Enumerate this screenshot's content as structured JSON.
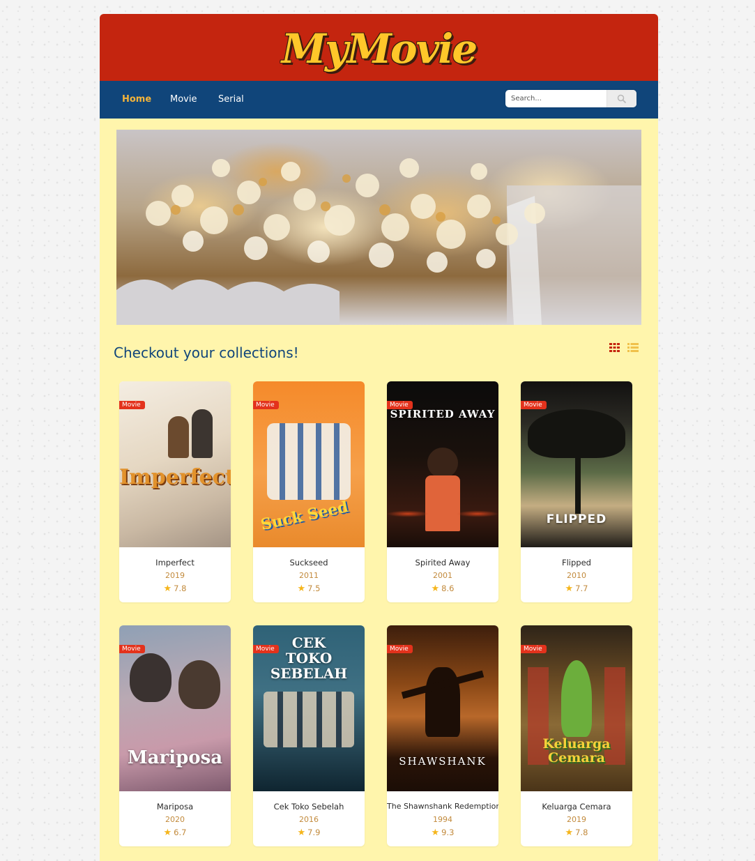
{
  "brand": {
    "logo_text": "MyMovie"
  },
  "nav": {
    "items": [
      {
        "label": "Home",
        "active": true
      },
      {
        "label": "Movie",
        "active": false
      },
      {
        "label": "Serial",
        "active": false
      }
    ],
    "search": {
      "placeholder": "Search...",
      "button_icon": "search-icon"
    }
  },
  "hero": {
    "image": "popcorn-banner",
    "alt": "popcorn"
  },
  "collections": {
    "title": "Checkout your collections!",
    "view_options": [
      {
        "icon": "grid-icon",
        "active": true,
        "color": "#c4250f"
      },
      {
        "icon": "list-icon",
        "active": false,
        "color": "#f0c14b"
      }
    ],
    "badge_color": "#e3321c",
    "items": [
      {
        "badge": "Movie",
        "title": "Imperfect",
        "year": "2019",
        "rating": "7.8",
        "poster_text": "Imperfect",
        "poster_colors": [
          "#efe6d8",
          "#c9b8a3",
          "#d6882a"
        ]
      },
      {
        "badge": "Movie",
        "title": "Suckseed",
        "year": "2011",
        "rating": "7.5",
        "poster_text": "Suck Seed",
        "poster_colors": [
          "#f39233",
          "#f6a54a",
          "#3e7bc2"
        ]
      },
      {
        "badge": "Movie",
        "title": "Spirited Away",
        "year": "2001",
        "rating": "8.6",
        "poster_text": "SPIRITED AWAY",
        "poster_colors": [
          "#0d0d0d",
          "#2a1a12",
          "#c8401a"
        ]
      },
      {
        "badge": "Movie",
        "title": "Flipped",
        "year": "2010",
        "rating": "7.7",
        "poster_text": "FLIPPED",
        "poster_colors": [
          "#1b1a17",
          "#4c5a3a",
          "#c9b48a"
        ]
      },
      {
        "badge": "Movie",
        "title": "Mariposa",
        "year": "2020",
        "rating": "6.7",
        "poster_text": "Mariposa",
        "poster_colors": [
          "#7d8fa6",
          "#b38a97",
          "#d6c3c8"
        ]
      },
      {
        "badge": "Movie",
        "title": "Cek Toko Sebelah",
        "year": "2016",
        "rating": "7.9",
        "poster_text": "CEK TOKO SEBELAH",
        "poster_colors": [
          "#2e5e73",
          "#3d6c7f",
          "#12303e"
        ]
      },
      {
        "badge": "Movie",
        "title": "The Shawnshank Redemption",
        "year": "1994",
        "rating": "9.3",
        "poster_text": "SHAWSHANK",
        "poster_colors": [
          "#2a1408",
          "#7a3d12",
          "#c2732a"
        ]
      },
      {
        "badge": "Movie",
        "title": "Keluarga Cemara",
        "year": "2019",
        "rating": "7.8",
        "poster_text": "Keluarga Cemara",
        "poster_colors": [
          "#3b2d1c",
          "#7d5a2a",
          "#6aa53b"
        ]
      }
    ]
  },
  "colors": {
    "brand_red": "#c4250f",
    "nav_blue": "#10457a",
    "page_bg": "#fff5ac",
    "accent_yellow": "#f4b43a"
  }
}
